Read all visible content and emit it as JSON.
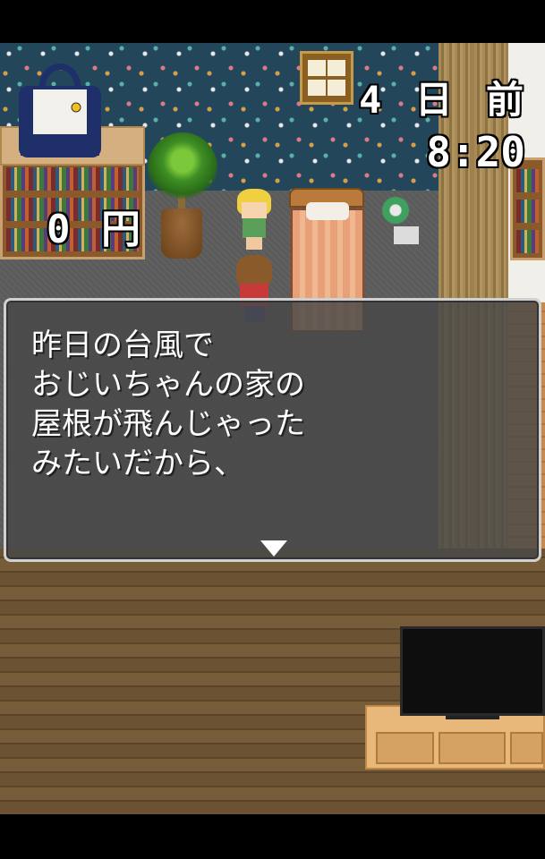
{
  "hud": {
    "day": "4 日 前",
    "time": "8:20",
    "money": "0 円"
  },
  "dialog": {
    "text": "昨日の台風で\nおじいちゃんの家の\n屋根が飛んじゃった\nみたいだから、"
  },
  "icons": {
    "inventory": "tote-bag-icon",
    "advance": "triangle-down-icon"
  },
  "colors": {
    "wallpaper": "#23465a",
    "dialog_bg": "#484848",
    "text": "#ffffff"
  }
}
